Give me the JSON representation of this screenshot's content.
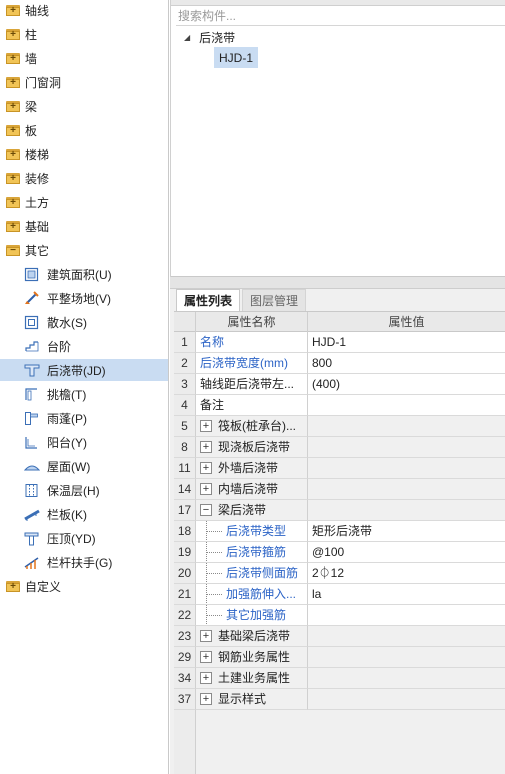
{
  "left_tree": {
    "folders_top": [
      {
        "label": "轴线",
        "expanded": false
      },
      {
        "label": "柱",
        "expanded": false
      },
      {
        "label": "墙",
        "expanded": false
      },
      {
        "label": "门窗洞",
        "expanded": false
      },
      {
        "label": "梁",
        "expanded": false
      },
      {
        "label": "板",
        "expanded": false
      },
      {
        "label": "楼梯",
        "expanded": false
      },
      {
        "label": "装修",
        "expanded": false
      },
      {
        "label": "土方",
        "expanded": false
      },
      {
        "label": "基础",
        "expanded": false
      },
      {
        "label": "其它",
        "expanded": true
      }
    ],
    "children": [
      {
        "label": "建筑面积(U)",
        "icon": "building-area-icon"
      },
      {
        "label": "平整场地(V)",
        "icon": "site-leveling-icon"
      },
      {
        "label": "散水(S)",
        "icon": "apron-icon"
      },
      {
        "label": "台阶",
        "icon": "steps-icon"
      },
      {
        "label": "后浇带(JD)",
        "icon": "post-cast-strip-icon",
        "selected": true
      },
      {
        "label": "挑檐(T)",
        "icon": "cornice-icon"
      },
      {
        "label": "雨蓬(P)",
        "icon": "canopy-icon"
      },
      {
        "label": "阳台(Y)",
        "icon": "balcony-icon"
      },
      {
        "label": "屋面(W)",
        "icon": "roof-icon"
      },
      {
        "label": "保温层(H)",
        "icon": "insulation-icon"
      },
      {
        "label": "栏板(K)",
        "icon": "parapet-icon"
      },
      {
        "label": "压顶(YD)",
        "icon": "coping-icon"
      },
      {
        "label": "栏杆扶手(G)",
        "icon": "railing-icon"
      }
    ],
    "folders_bottom": [
      {
        "label": "自定义",
        "expanded": false
      }
    ]
  },
  "component_list": {
    "search_placeholder": "搜索构件...",
    "root": "后浇带",
    "items": [
      "HJD-1"
    ]
  },
  "properties": {
    "tabs": [
      "属性列表",
      "图层管理"
    ],
    "active_tab": "属性列表",
    "headers": {
      "name": "属性名称",
      "value": "属性值"
    },
    "rows": [
      {
        "num": "1",
        "name": "名称",
        "value": "HJD-1",
        "blue": true,
        "kind": "plain"
      },
      {
        "num": "2",
        "name": "后浇带宽度(mm)",
        "value": "800",
        "blue": true,
        "kind": "plain"
      },
      {
        "num": "3",
        "name": "轴线距后浇带左...",
        "value": "(400)",
        "blue": false,
        "kind": "plain"
      },
      {
        "num": "4",
        "name": "备注",
        "value": "",
        "blue": false,
        "kind": "plain"
      },
      {
        "num": "5",
        "name": "筏板(桩承台)...",
        "value": "",
        "blue": false,
        "kind": "group",
        "sign": "+"
      },
      {
        "num": "8",
        "name": "现浇板后浇带",
        "value": "",
        "blue": false,
        "kind": "group",
        "sign": "+"
      },
      {
        "num": "11",
        "name": "外墙后浇带",
        "value": "",
        "blue": false,
        "kind": "group",
        "sign": "+"
      },
      {
        "num": "14",
        "name": "内墙后浇带",
        "value": "",
        "blue": false,
        "kind": "group",
        "sign": "+"
      },
      {
        "num": "17",
        "name": "梁后浇带",
        "value": "",
        "blue": false,
        "kind": "group",
        "sign": "−"
      },
      {
        "num": "18",
        "name": "后浇带类型",
        "value": "矩形后浇带",
        "blue": true,
        "kind": "sub"
      },
      {
        "num": "19",
        "name": "后浇带箍筋",
        "value": "@100",
        "blue": true,
        "kind": "sub"
      },
      {
        "num": "20",
        "name": "后浇带侧面筋",
        "value": "2⏀12",
        "blue": true,
        "kind": "sub"
      },
      {
        "num": "21",
        "name": "加强筋伸入...",
        "value": "la",
        "blue": true,
        "kind": "sub"
      },
      {
        "num": "22",
        "name": "其它加强筋",
        "value": "",
        "blue": true,
        "kind": "sub"
      },
      {
        "num": "23",
        "name": "基础梁后浇带",
        "value": "",
        "blue": false,
        "kind": "group",
        "sign": "+"
      },
      {
        "num": "29",
        "name": "钢筋业务属性",
        "value": "",
        "blue": false,
        "kind": "group",
        "sign": "+"
      },
      {
        "num": "34",
        "name": "土建业务属性",
        "value": "",
        "blue": false,
        "kind": "group",
        "sign": "+"
      },
      {
        "num": "37",
        "name": "显示样式",
        "value": "",
        "blue": false,
        "kind": "group",
        "sign": "+"
      }
    ]
  }
}
